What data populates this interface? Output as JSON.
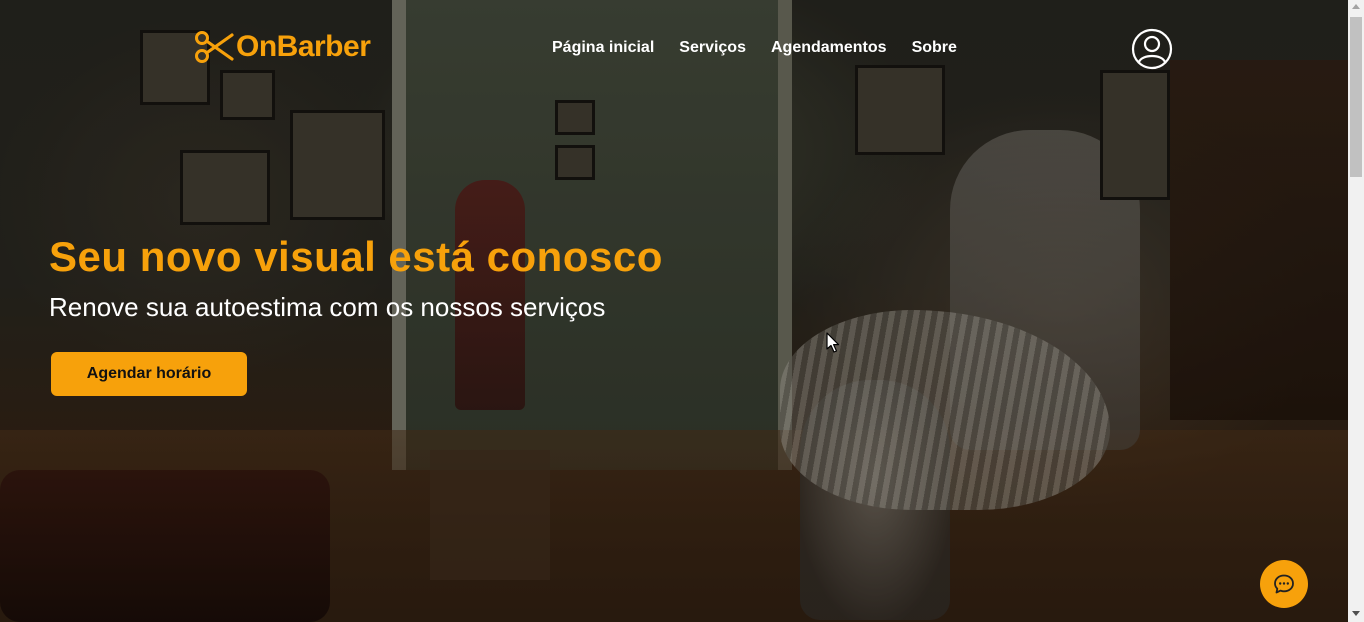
{
  "brand": {
    "name": "OnBarber",
    "icon": "scissors-icon",
    "accent_color": "#f7a10b"
  },
  "nav": {
    "items": [
      {
        "label": "Página inicial"
      },
      {
        "label": "Serviços"
      },
      {
        "label": "Agendamentos"
      },
      {
        "label": "Sobre"
      }
    ],
    "account_icon": "user-circle-icon"
  },
  "hero": {
    "headline": "Seu novo visual está conosco",
    "subheadline": "Renove sua autoestima com os nossos serviços",
    "cta_label": "Agendar horário",
    "background": "barbershop-photo"
  },
  "chat": {
    "icon": "chat-bubble-icon"
  }
}
